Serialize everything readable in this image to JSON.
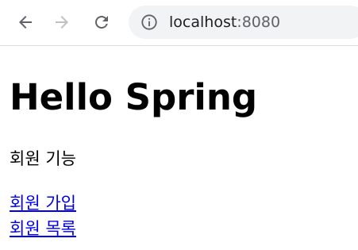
{
  "browser": {
    "url_host": "localhost",
    "url_port": ":8080",
    "icons": {
      "back": "arrow-left-icon",
      "forward": "arrow-right-icon",
      "reload": "reload-icon",
      "site_info": "info-icon"
    }
  },
  "page": {
    "title": "Hello Spring",
    "section_label": "회원 기능",
    "links": [
      {
        "label": "회원 가입"
      },
      {
        "label": "회원 목록"
      }
    ],
    "link_color": "#0000ee"
  }
}
